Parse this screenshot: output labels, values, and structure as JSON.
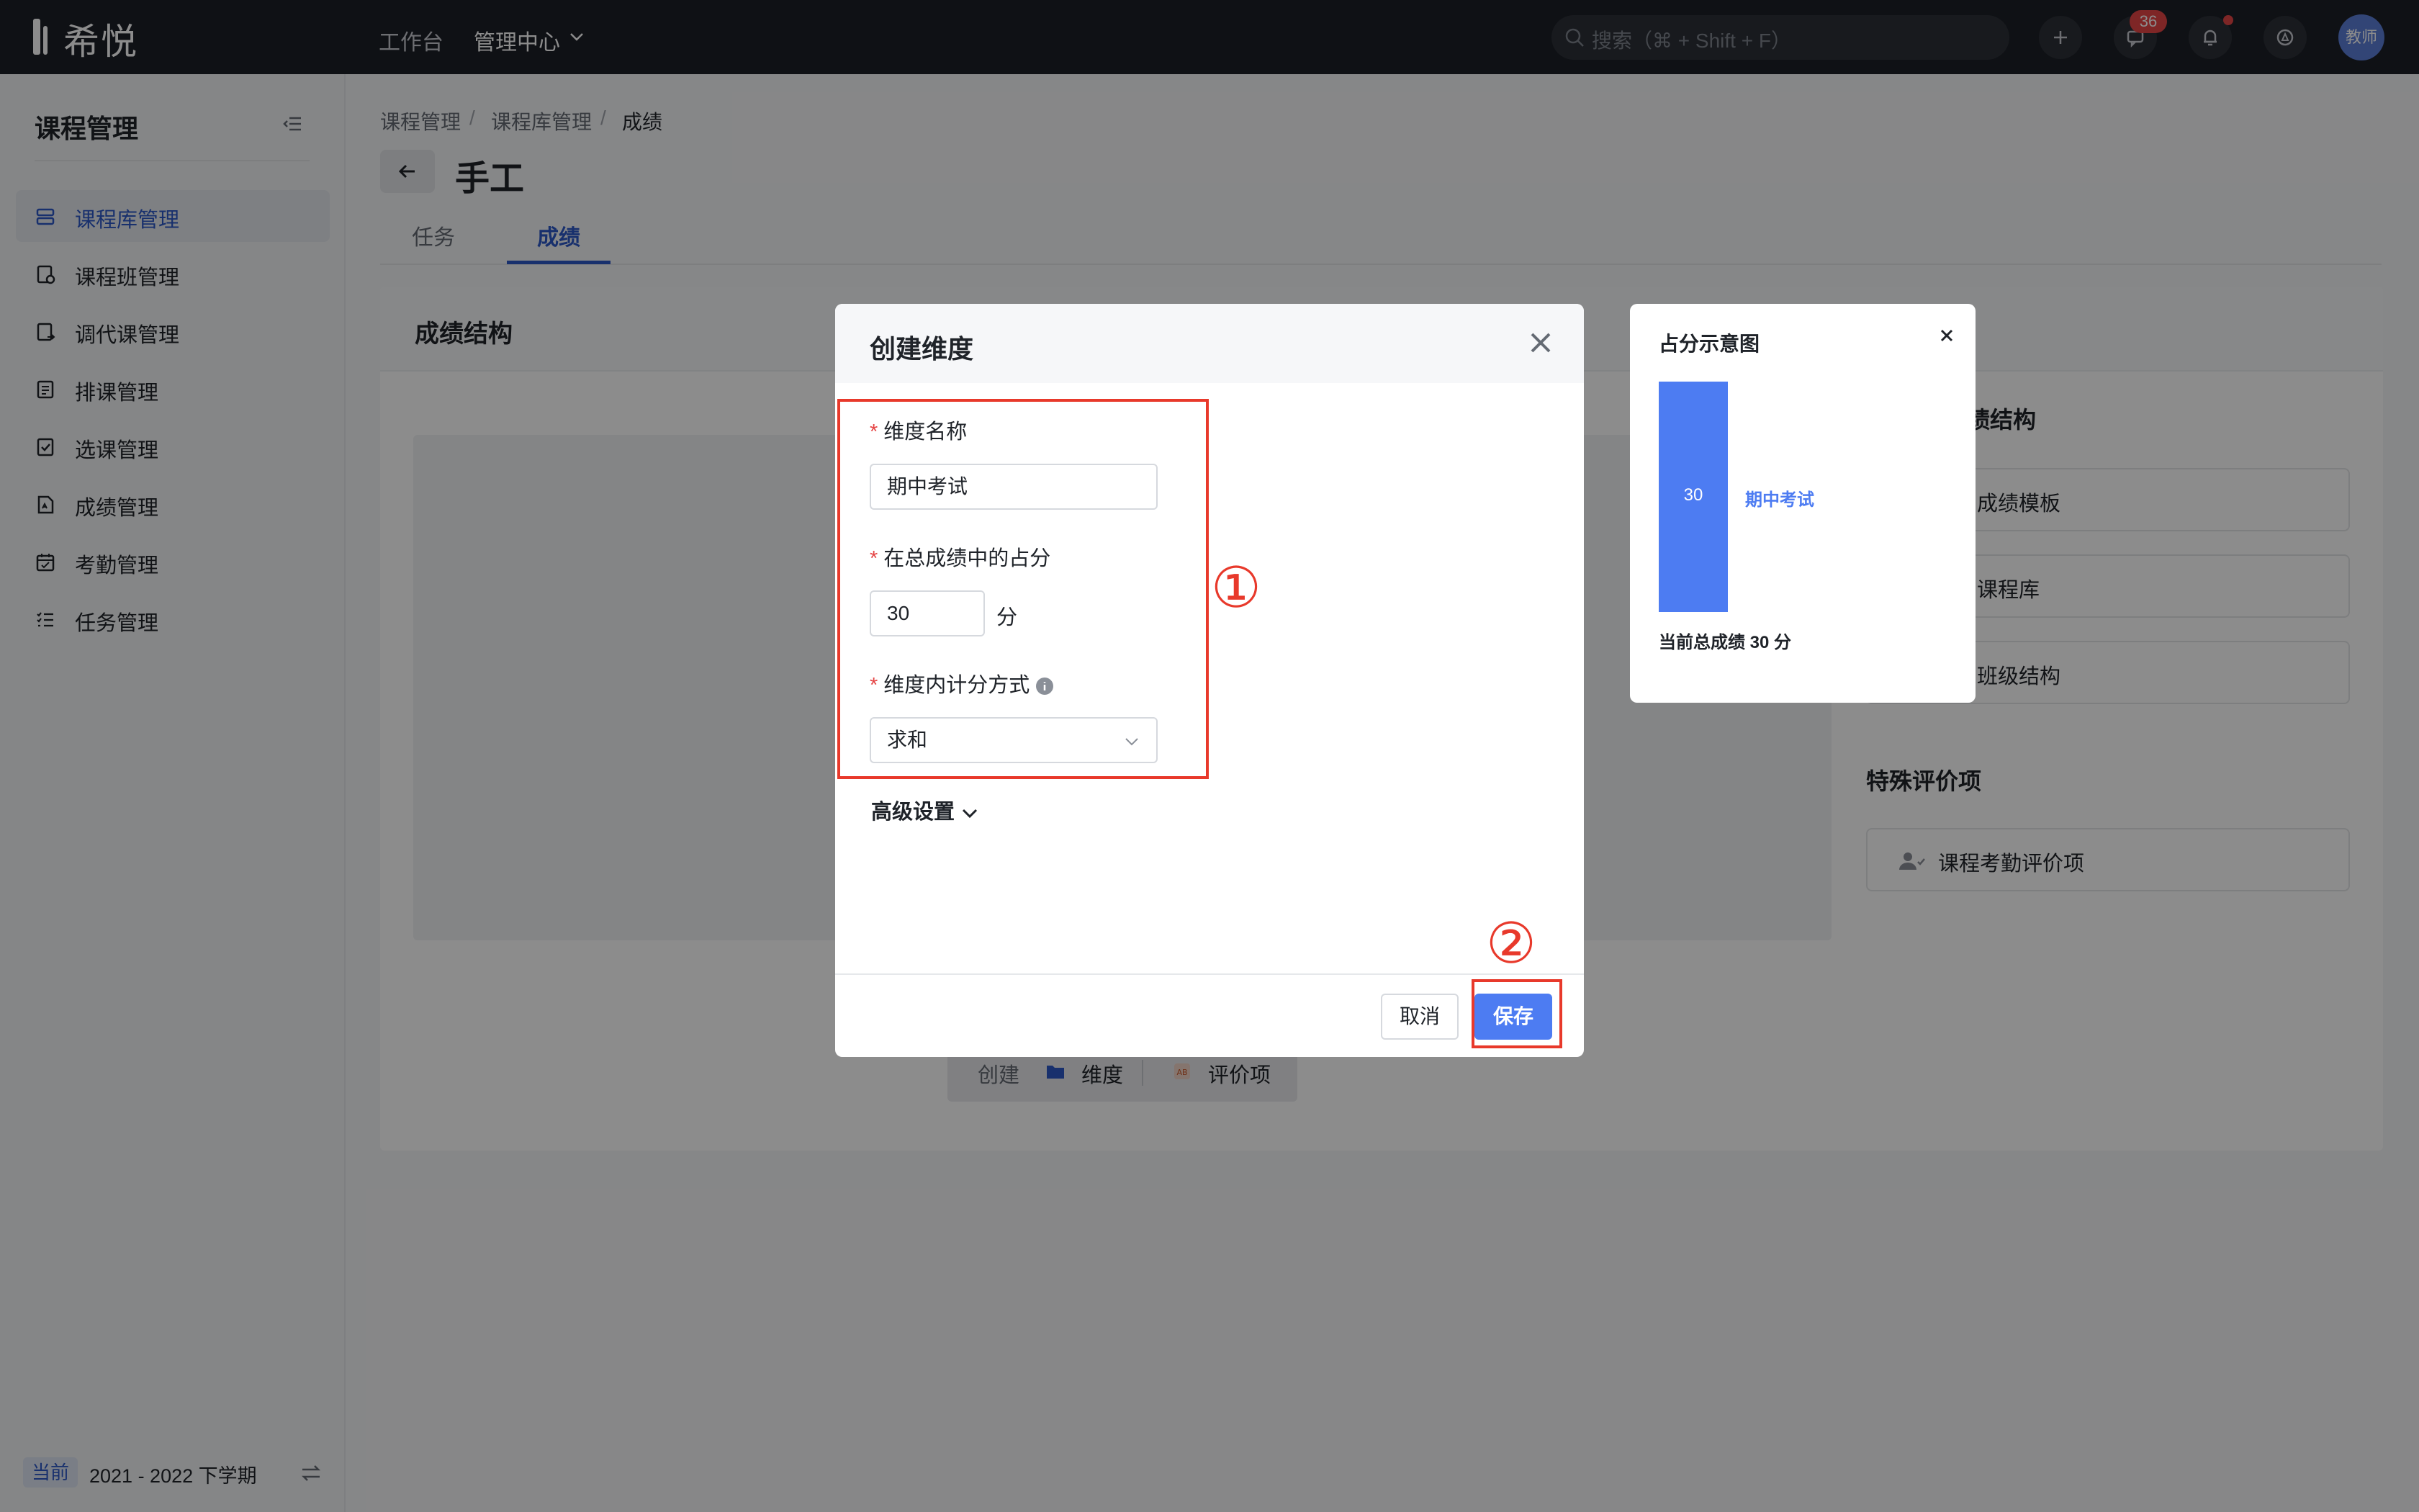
{
  "app": {
    "brand": "希悦",
    "nav": [
      "工作台",
      "管理中心"
    ],
    "search_placeholder": "搜索（⌘ + Shift + F）",
    "message_count": "36",
    "avatar_label": "教师"
  },
  "sidebar": {
    "title": "课程管理",
    "items": [
      {
        "label": "课程库管理",
        "icon": "course-library-icon"
      },
      {
        "label": "课程班管理",
        "icon": "course-class-icon"
      },
      {
        "label": "调代课管理",
        "icon": "substitute-icon"
      },
      {
        "label": "排课管理",
        "icon": "schedule-icon"
      },
      {
        "label": "选课管理",
        "icon": "course-selection-icon"
      },
      {
        "label": "成绩管理",
        "icon": "grade-icon"
      },
      {
        "label": "考勤管理",
        "icon": "attendance-icon"
      },
      {
        "label": "任务管理",
        "icon": "task-icon"
      }
    ],
    "active_index": 0,
    "term_tag": "当前",
    "term": "2021 - 2022 下学期"
  },
  "breadcrumb": [
    "课程管理",
    "课程库管理",
    "成绩"
  ],
  "page": {
    "title": "手工",
    "tabs": [
      "任务",
      "成绩"
    ],
    "active_tab": 1,
    "card_title": "成绩结构",
    "right_heading": "成绩结构",
    "right_buttons": [
      "成绩模板",
      "课程库",
      "班级结构"
    ],
    "special_heading": "特殊评价项",
    "attendance_item": "课程考勤评价项",
    "create_bar": {
      "create": "创建",
      "dimension": "维度",
      "item": "评价项"
    }
  },
  "dialog": {
    "title": "创建维度",
    "name_label": "维度名称",
    "name_value": "期中考试",
    "weight_label": "在总成绩中的占分",
    "weight_value": "30",
    "weight_unit": "分",
    "method_label": "维度内计分方式",
    "method_value": "求和",
    "advanced": "高级设置",
    "cancel": "取消",
    "save": "保存"
  },
  "preview": {
    "title": "占分示意图",
    "bar_value": "30",
    "bar_label": "期中考试",
    "total_text": "当前总成绩 30 分"
  },
  "annotations": [
    "①",
    "②"
  ],
  "colors": {
    "accent": "#4d7cf2",
    "annotation": "#e8392b",
    "topbar": "#1d2027"
  }
}
